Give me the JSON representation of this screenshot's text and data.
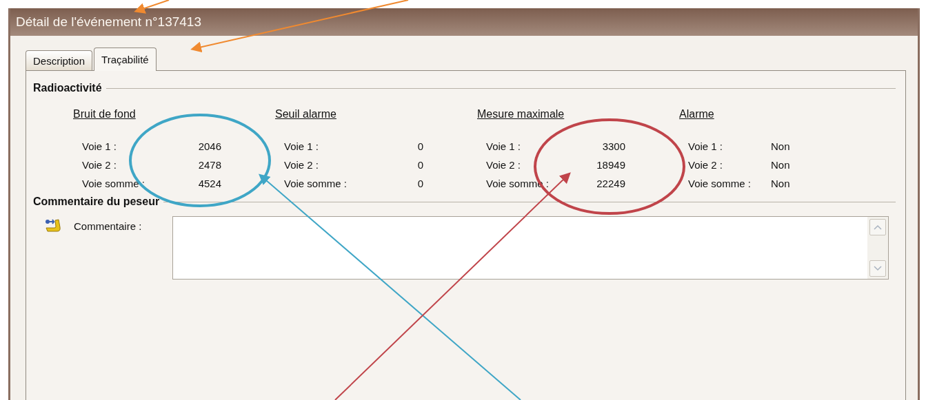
{
  "window": {
    "title": "Détail de l'événement n°137413"
  },
  "tabs": [
    {
      "label": "Description",
      "selected": false
    },
    {
      "label": "Traçabilité",
      "selected": true
    }
  ],
  "radioactivity": {
    "title": "Radioactivité",
    "groups": [
      {
        "heading": "Bruit de fond",
        "kind": "count",
        "rows": [
          {
            "label": "Voie 1 :",
            "value": "2046"
          },
          {
            "label": "Voie 2 :",
            "value": "2478"
          },
          {
            "label": "Voie somme :",
            "value": "4524"
          }
        ]
      },
      {
        "heading": "Seuil alarme",
        "kind": "count",
        "rows": [
          {
            "label": "Voie 1 :",
            "value": "0"
          },
          {
            "label": "Voie 2 :",
            "value": "0"
          },
          {
            "label": "Voie somme :",
            "value": "0"
          }
        ]
      },
      {
        "heading": "Mesure maximale",
        "kind": "count",
        "rows": [
          {
            "label": "Voie 1 :",
            "value": "3300"
          },
          {
            "label": "Voie 2 :",
            "value": "18949"
          },
          {
            "label": "Voie somme :",
            "value": "22249"
          }
        ]
      },
      {
        "heading": "Alarme",
        "kind": "flag",
        "rows": [
          {
            "label": "Voie 1 :",
            "value": "Non"
          },
          {
            "label": "Voie 2 :",
            "value": "Non"
          },
          {
            "label": "Voie somme :",
            "value": "Non"
          }
        ]
      }
    ]
  },
  "comment": {
    "title": "Commentaire du peseur",
    "label": "Commentaire :"
  }
}
